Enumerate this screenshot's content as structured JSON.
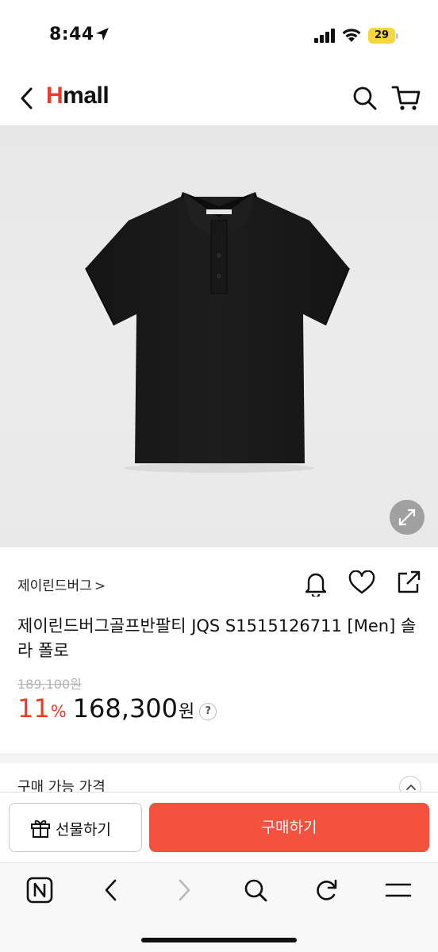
{
  "status_bar": {
    "time": "8:44",
    "battery": "29",
    "icons": [
      "location-arrow-icon",
      "signal-icon",
      "wifi-icon",
      "battery-icon"
    ]
  },
  "header": {
    "logo_h": "H",
    "logo_rest": "mall",
    "icons": [
      "back-arrow-icon",
      "search-icon",
      "cart-icon"
    ]
  },
  "product": {
    "brand": "제이린드버그",
    "brand_chevron": ">",
    "title": "제이린드버그골프반팔티 JQS S1515126711 [Men] 솔라 폴로",
    "original_price": "189,100원",
    "discount_value": "11",
    "discount_unit": "%",
    "price": "168,300",
    "currency": "원",
    "help": "?",
    "actions_icons": [
      "bell-icon",
      "heart-icon",
      "share-icon"
    ],
    "image_icon": "expand-icon"
  },
  "available_price": {
    "label": "구매 가능 가격"
  },
  "bottom_actions": {
    "gift_label": "선물하기",
    "buy_label": "구매하기"
  },
  "browser_toolbar": {
    "icons": [
      "naver-home-icon",
      "back-icon",
      "forward-icon",
      "search-icon",
      "refresh-icon",
      "menu-icon"
    ]
  },
  "colors": {
    "brand_red": "#ef3b2c",
    "buy_button": "#f4523e",
    "battery": "#f5d63c"
  }
}
